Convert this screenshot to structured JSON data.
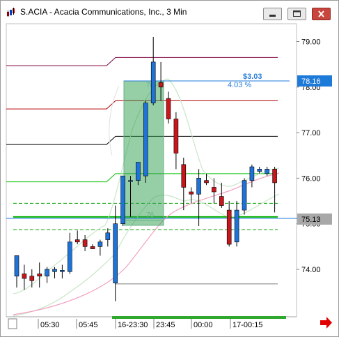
{
  "window": {
    "title": "S.ACIA - Acacia Communications, Inc., 3 Min",
    "buttons": [
      "minimize",
      "restore",
      "close"
    ]
  },
  "chart_data": {
    "type": "candlestick",
    "symbol": "S.ACIA",
    "price_axis": {
      "ticks": [
        "79.00",
        "78.00",
        "77.00",
        "76.00",
        "75.00",
        "74.00"
      ],
      "ylim": [
        73.3,
        79.3
      ],
      "current_price": "78.16",
      "reference_price": "75.13"
    },
    "time_axis": {
      "labels": [
        "05:30",
        "05:45",
        "16-23:30",
        "23:45",
        "00:00",
        "17-00:15"
      ]
    },
    "measure_tool": {
      "change": "$3.03",
      "percent": "4.03 %",
      "bars_start": "76",
      "bars_end": "76"
    },
    "levels": [
      {
        "price": 78.65,
        "color": "#800040",
        "style": "solid"
      },
      {
        "price": 77.7,
        "color": "#b00000",
        "style": "solid"
      },
      {
        "price": 76.92,
        "color": "#000000",
        "style": "solid"
      },
      {
        "price": 76.1,
        "color": "#00c000",
        "style": "solid"
      },
      {
        "price": 75.45,
        "color": "#00a000",
        "style": "dashed"
      },
      {
        "price": 75.15,
        "color": "#00b000",
        "style": "solid"
      },
      {
        "price": 74.87,
        "color": "#00a000",
        "style": "dashed"
      },
      {
        "price": 73.68,
        "color": "#808080",
        "style": "solid"
      }
    ],
    "candles": [
      {
        "o": 73.85,
        "h": 74.3,
        "l": 73.6,
        "c": 74.3
      },
      {
        "o": 73.9,
        "h": 74.1,
        "l": 73.55,
        "c": 73.8
      },
      {
        "o": 73.85,
        "h": 74.0,
        "l": 73.6,
        "c": 73.75
      },
      {
        "o": 73.9,
        "h": 74.15,
        "l": 73.6,
        "c": 73.85
      },
      {
        "o": 73.85,
        "h": 74.05,
        "l": 73.7,
        "c": 74.0
      },
      {
        "o": 73.95,
        "h": 74.05,
        "l": 73.8,
        "c": 74.0
      },
      {
        "o": 73.95,
        "h": 74.1,
        "l": 73.8,
        "c": 73.98
      },
      {
        "o": 73.95,
        "h": 74.8,
        "l": 73.9,
        "c": 74.6
      },
      {
        "o": 74.65,
        "h": 74.85,
        "l": 74.55,
        "c": 74.6
      },
      {
        "o": 74.65,
        "h": 74.75,
        "l": 74.4,
        "c": 74.5
      },
      {
        "o": 74.5,
        "h": 74.55,
        "l": 74.45,
        "c": 74.45
      },
      {
        "o": 74.5,
        "h": 74.65,
        "l": 74.3,
        "c": 74.6
      },
      {
        "o": 74.65,
        "h": 74.9,
        "l": 74.5,
        "c": 74.8
      },
      {
        "o": 73.7,
        "h": 75.4,
        "l": 73.3,
        "c": 75.0
      },
      {
        "o": 75.0,
        "h": 76.05,
        "l": 74.95,
        "c": 76.05
      },
      {
        "o": 75.95,
        "h": 76.05,
        "l": 75.15,
        "c": 75.95
      },
      {
        "o": 75.95,
        "h": 76.35,
        "l": 75.85,
        "c": 76.35
      },
      {
        "o": 76.05,
        "h": 77.7,
        "l": 75.9,
        "c": 77.65
      },
      {
        "o": 77.65,
        "h": 79.1,
        "l": 77.6,
        "c": 78.55
      },
      {
        "o": 78.1,
        "h": 78.55,
        "l": 77.7,
        "c": 78.0
      },
      {
        "o": 77.75,
        "h": 77.9,
        "l": 77.2,
        "c": 77.3
      },
      {
        "o": 77.3,
        "h": 77.45,
        "l": 76.2,
        "c": 76.55
      },
      {
        "o": 76.3,
        "h": 76.45,
        "l": 75.3,
        "c": 75.8
      },
      {
        "o": 75.7,
        "h": 75.8,
        "l": 75.45,
        "c": 75.65
      },
      {
        "o": 75.65,
        "h": 76.2,
        "l": 74.95,
        "c": 76.0
      },
      {
        "o": 75.95,
        "h": 76.1,
        "l": 75.85,
        "c": 75.9
      },
      {
        "o": 75.8,
        "h": 76.0,
        "l": 75.45,
        "c": 75.7
      },
      {
        "o": 75.6,
        "h": 75.9,
        "l": 75.35,
        "c": 75.4
      },
      {
        "o": 75.3,
        "h": 75.5,
        "l": 74.5,
        "c": 74.55
      },
      {
        "o": 74.6,
        "h": 75.5,
        "l": 74.5,
        "c": 75.3
      },
      {
        "o": 75.3,
        "h": 76.0,
        "l": 75.2,
        "c": 75.95
      },
      {
        "o": 75.95,
        "h": 76.3,
        "l": 75.8,
        "c": 76.25
      },
      {
        "o": 76.15,
        "h": 76.25,
        "l": 76.1,
        "c": 76.2
      },
      {
        "o": 76.1,
        "h": 76.25,
        "l": 76.05,
        "c": 76.2
      },
      {
        "o": 76.2,
        "h": 76.25,
        "l": 75.25,
        "c": 75.9
      }
    ]
  }
}
